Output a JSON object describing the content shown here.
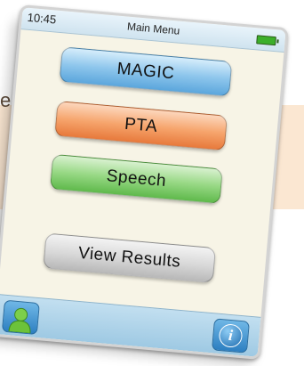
{
  "background": {
    "partial_text": "e"
  },
  "device": {
    "status_bar": {
      "time": "10:45",
      "title": "Main Menu",
      "battery_color": "#3caf2a"
    },
    "menu": {
      "magic_label": "MAGIC",
      "pta_label": "PTA",
      "speech_label": "Speech",
      "view_results_label": "View Results"
    },
    "bottom_bar": {
      "user_icon": "user-icon",
      "info_icon": "info-icon",
      "info_glyph": "i"
    }
  }
}
